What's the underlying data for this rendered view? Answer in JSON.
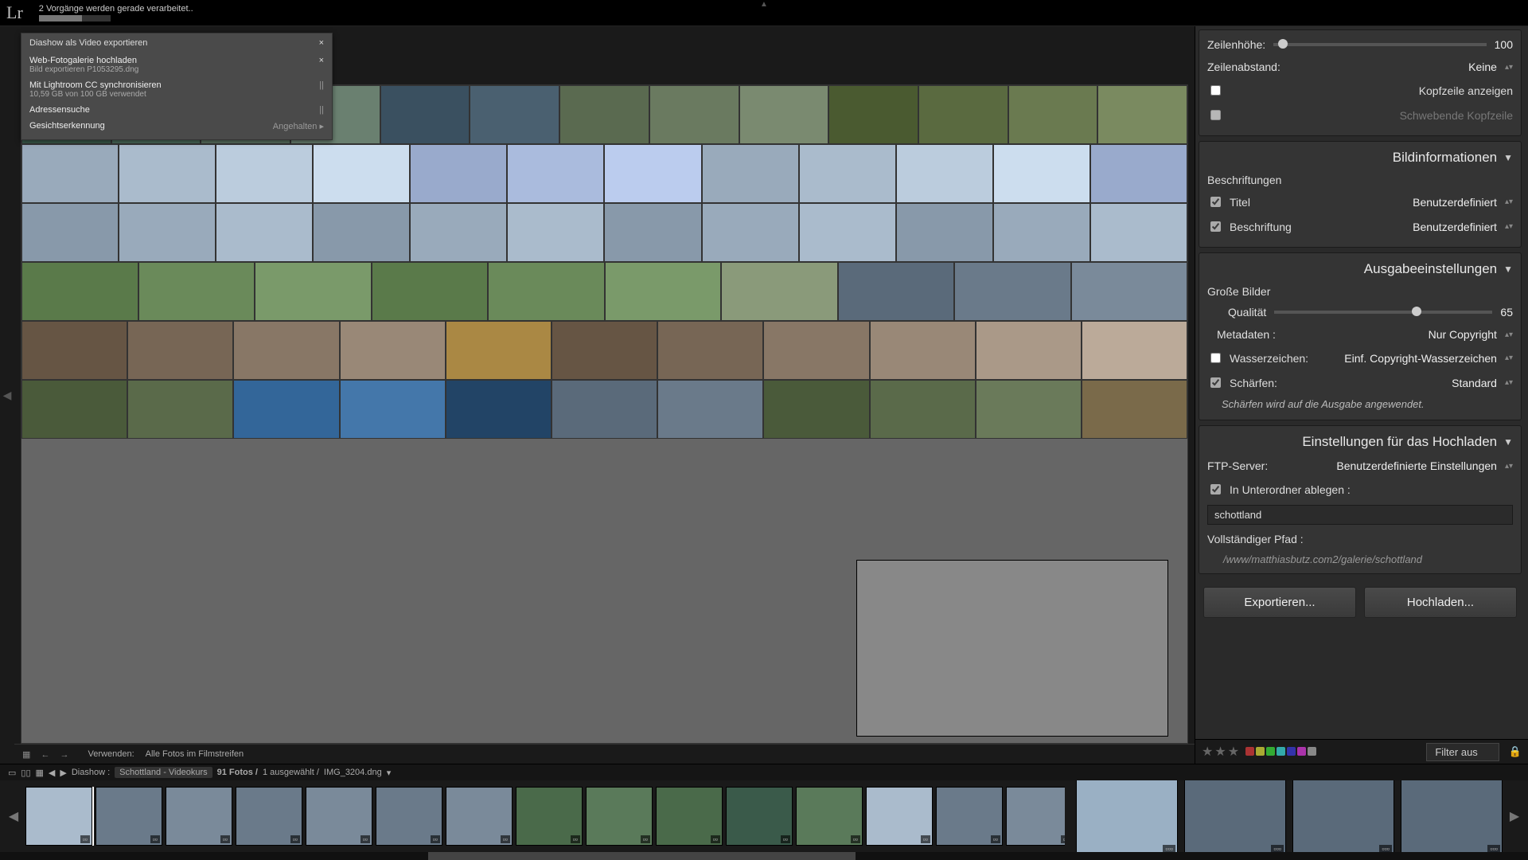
{
  "top": {
    "logo": "Lr",
    "processing_label": "2 Vorgänge werden gerade verarbeitet..",
    "collapse": "▲"
  },
  "tasks": {
    "header": "Diashow als Video exportieren",
    "items": [
      {
        "title": "Web-Fotogalerie hochladen",
        "sub": "Bild exportieren P1053295.dng",
        "action": "×"
      },
      {
        "title": "Mit Lightroom CC synchronisieren",
        "sub": "10,59 GB von 100 GB verwendet",
        "action": "||"
      },
      {
        "title": "Adressensuche",
        "sub": "",
        "action": "||"
      },
      {
        "title": "Gesichtserkennung",
        "sub": "",
        "action": "Angehalten  ▸"
      }
    ],
    "close": "×"
  },
  "gridbar": {
    "use_label": "Verwenden:",
    "use_value": "Alle Fotos im Filmstreifen"
  },
  "strip": {
    "nav_prev": "◀",
    "nav_next": "▶",
    "crumb1": "Diashow :",
    "crumb2": "Schottland - Videokurs",
    "count": "91 Fotos /",
    "selected": "1 ausgewählt /",
    "file": "IMG_3204.dng",
    "caret": "▾"
  },
  "panels": {
    "zeile": {
      "row_height_label": "Zeilenhöhe:",
      "row_height_value": "100",
      "row_spacing_label": "Zeilenabstand:",
      "row_spacing_value": "Keine",
      "show_header": "Kopfzeile anzeigen",
      "float_header": "Schwebende Kopfzeile"
    },
    "bildinfo": {
      "title": "Bildinformationen",
      "section": "Beschriftungen",
      "titel_label": "Titel",
      "titel_value": "Benutzerdefiniert",
      "beschr_label": "Beschriftung",
      "beschr_value": "Benutzerdefiniert"
    },
    "ausgabe": {
      "title": "Ausgabeeinstellungen",
      "section": "Große Bilder",
      "quality_label": "Qualität",
      "quality_value": "65",
      "metadata_label": "Metadaten :",
      "metadata_value": "Nur Copyright",
      "wasser_label": "Wasserzeichen:",
      "wasser_value": "Einf. Copyright-Wasserzeichen",
      "sharpen_label": "Schärfen:",
      "sharpen_value": "Standard",
      "sharpen_hint": "Schärfen wird auf die Ausgabe angewendet."
    },
    "upload": {
      "title": "Einstellungen für das Hochladen",
      "ftp_label": "FTP-Server:",
      "ftp_value": "Benutzerdefinierte Einstellungen",
      "subfolder_label": "In Unterordner ablegen :",
      "subfolder_value": "schottland",
      "fullpath_label": "Vollständiger Pfad :",
      "fullpath_value": "/www/matthiasbutz.com2/galerie/schottland"
    },
    "buttons": {
      "export": "Exportieren...",
      "upload": "Hochladen..."
    }
  },
  "filterbar": {
    "filter_label": "Filter aus"
  },
  "grid": {
    "row_colors": [
      [
        "#3a5a4a",
        "#4a6a5a",
        "#5a7060",
        "#6a8070",
        "#3a5060",
        "#4a6070",
        "#5a6a50",
        "#6a7a60",
        "#7a8a70",
        "#4a5a30",
        "#5a6a40",
        "#6a7a50",
        "#7a8a60"
      ],
      [
        "#9ab",
        "#abc",
        "#bcd",
        "#cde",
        "#9ac",
        "#abd",
        "#bce",
        "#9ab",
        "#abc",
        "#bcd",
        "#cde",
        "#9ac"
      ],
      [
        "#89a",
        "#9ab",
        "#abc",
        "#89a",
        "#9ab",
        "#abc",
        "#89a",
        "#9ab",
        "#abc",
        "#89a",
        "#9ab",
        "#abc"
      ],
      [
        "#5a7a4a",
        "#6a8a5a",
        "#7a9a6a",
        "#5a7a4a",
        "#6a8a5a",
        "#7a9a6a",
        "#8a9a7a",
        "#5a6a7a",
        "#6a7a8a",
        "#7a8a9a"
      ],
      [
        "#665544",
        "#776655",
        "#887766",
        "#998877",
        "#aa8844",
        "#665544",
        "#776655",
        "#887766",
        "#998877",
        "#aa9988",
        "#bbaa99"
      ],
      [
        "#4a5a3a",
        "#5a6a4a",
        "#336699",
        "#4477aa",
        "#224466",
        "#5a6a7a",
        "#6a7a8a",
        "#4a5a3a",
        "#5a6a4a",
        "#6a7a5a",
        "#7a6a4a"
      ]
    ]
  },
  "thumbs": {
    "small_colors": [
      "#aabbcc",
      "#6a7a8a",
      "#7a8a9a",
      "#6a7a8a",
      "#7a8a9a",
      "#6a7a8a",
      "#7a8a9a",
      "#4a6a4a",
      "#5a7a5a",
      "#4a6a4a",
      "#3a5a4a",
      "#5a7a5a",
      "#aabbcc",
      "#6a7a8a",
      "#7a8a9a",
      "#6a7a8a",
      "#7a8a9a"
    ],
    "big_colors": [
      "#9ab0c4",
      "#5a6a7a",
      "#5a6a7a",
      "#5a6a7a"
    ]
  }
}
